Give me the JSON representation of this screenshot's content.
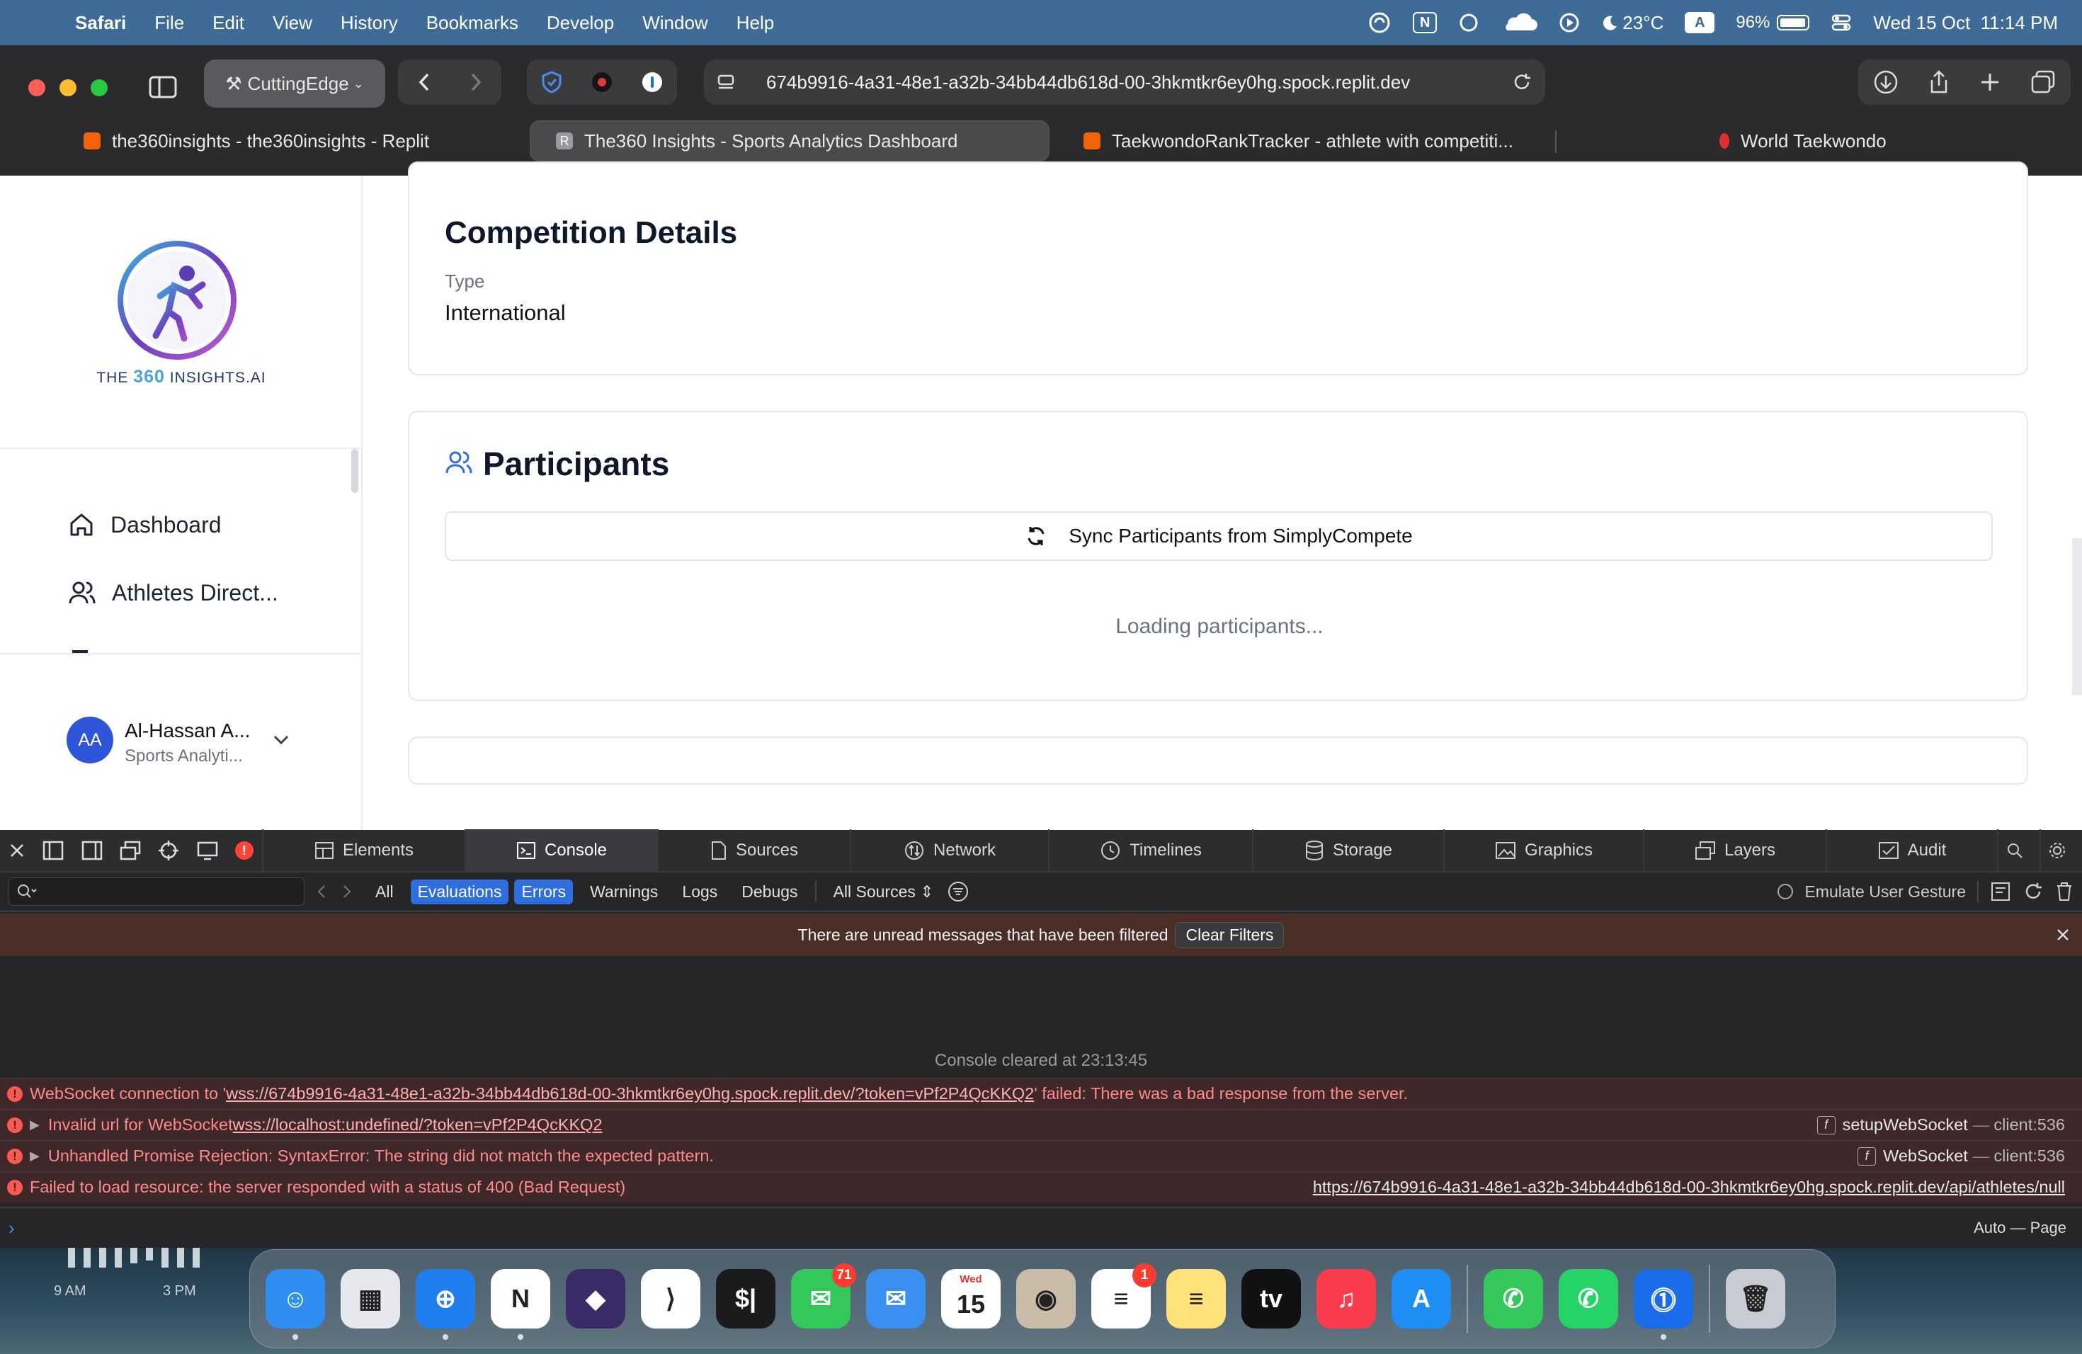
{
  "menubar": {
    "app": "Safari",
    "items": [
      "File",
      "Edit",
      "View",
      "History",
      "Bookmarks",
      "Develop",
      "Window",
      "Help"
    ],
    "weather": "23°C",
    "input_source": "A",
    "battery": "96%",
    "battery_level": 0.96,
    "datetime": "Wed 15 Oct  11:14 PM",
    "notion_glyph": "N"
  },
  "browser": {
    "profile": "CuttingEdge",
    "url": "674b9916-4a31-48e1-a32b-34bb44db618d-00-3hkmtkr6ey0hg.spock.replit.dev",
    "tabs": [
      {
        "label": "the360insights - the360insights - Replit",
        "favicon_color": "#f26207"
      },
      {
        "label": "The360 Insights - Sports Analytics Dashboard",
        "favicon_color": "#9a9aa0",
        "favicon_letter": "R"
      },
      {
        "label": "TaekwondoRankTracker - athlete with competiti...",
        "favicon_color": "#f26207"
      },
      {
        "label": "World Taekwondo",
        "favicon_color": "#e03030"
      }
    ]
  },
  "sidebar": {
    "logo_text_pre": "THE",
    "logo_text_num": "360",
    "logo_text_post": "INSIGHTS.AI",
    "nav": [
      {
        "label": "Dashboard",
        "icon": "home-icon"
      },
      {
        "label": "Athletes Direct...",
        "icon": "users-icon"
      }
    ],
    "user": {
      "initials": "AA",
      "name": "Al-Hassan A...",
      "role": "Sports Analyti..."
    }
  },
  "competition": {
    "title": "Competition Details",
    "type_label": "Type",
    "type_value": "International"
  },
  "participants": {
    "title": "Participants",
    "sync_label": "Sync Participants from SimplyCompete",
    "loading": "Loading participants..."
  },
  "devtools": {
    "tabs": [
      "Elements",
      "Console",
      "Sources",
      "Network",
      "Timelines",
      "Storage",
      "Graphics",
      "Layers",
      "Audit"
    ],
    "selected_tab": "Console",
    "filters": [
      "All",
      "Evaluations",
      "Errors",
      "Warnings",
      "Logs",
      "Debugs"
    ],
    "active_filters": [
      "Evaluations",
      "Errors"
    ],
    "sources": "All Sources",
    "emulate": "Emulate User Gesture",
    "notice": "There are unread messages that have been filtered",
    "clear_filters": "Clear Filters",
    "cleared": "Console cleared at 23:13:45",
    "errors": [
      {
        "pre": "WebSocket connection to '",
        "link": "wss://674b9916-4a31-48e1-a32b-34bb44db618d-00-3hkmtkr6ey0hg.spock.replit.dev/?token=vPf2P4QcKKQ2",
        "post": "' failed: There was a bad response from the server."
      },
      {
        "pre": "Invalid url for WebSocket ",
        "link": "wss://localhost:undefined/?token=vPf2P4QcKKQ2",
        "post": "",
        "fn": "setupWebSocket",
        "loc": "client:536"
      },
      {
        "pre": "Unhandled Promise Rejection: SyntaxError: The string did not match the expected pattern.",
        "link": "",
        "post": "",
        "fn": "WebSocket",
        "loc": "client:536"
      },
      {
        "pre": "Failed to load resource: the server responded with a status of 400 (Bad Request)",
        "link": "",
        "post": "",
        "url": "https://674b9916-4a31-48e1-a32b-34bb44db618d-00-3hkmtkr6ey0hg.spock.replit.dev/api/athletes/null"
      }
    ],
    "context": "Auto — Page",
    "separator": "—"
  },
  "desktop": {
    "widget_times": [
      "9 AM",
      "3 PM"
    ]
  },
  "dock": {
    "apps": [
      {
        "name": "Finder",
        "color": "#2f8ef0",
        "glyph": "☺"
      },
      {
        "name": "Launchpad",
        "color": "#e6e8ee",
        "glyph": "▦"
      },
      {
        "name": "Safari",
        "color": "#1f7ff0",
        "glyph": "⊕"
      },
      {
        "name": "Notion",
        "color": "#ffffff",
        "glyph": "N"
      },
      {
        "name": "Obsidian",
        "color": "#3a2a66",
        "glyph": "◆"
      },
      {
        "name": "VS Code",
        "color": "#ffffff",
        "glyph": "⟩"
      },
      {
        "name": "Terminal",
        "color": "#1b1b1b",
        "glyph": "$|"
      },
      {
        "name": "Messages",
        "color": "#34c759",
        "glyph": "✉",
        "badge": "71"
      },
      {
        "name": "Mail",
        "color": "#3b8ff0",
        "glyph": "✉"
      },
      {
        "name": "Calendar",
        "color": "#ffffff",
        "glyph": "15",
        "sub": "Wed"
      },
      {
        "name": "Contacts",
        "color": "#c9bca8",
        "glyph": "◉"
      },
      {
        "name": "Reminders",
        "color": "#ffffff",
        "glyph": "≡",
        "badge": "1"
      },
      {
        "name": "Notes",
        "color": "#ffe27a",
        "glyph": "≡"
      },
      {
        "name": "TV",
        "color": "#111111",
        "glyph": "tv"
      },
      {
        "name": "Music",
        "color": "#fa3c4c",
        "glyph": "♫"
      },
      {
        "name": "App Store",
        "color": "#1e8ef5",
        "glyph": "A"
      },
      {
        "name": "Phone",
        "color": "#34c759",
        "glyph": "✆"
      },
      {
        "name": "WhatsApp",
        "color": "#25d366",
        "glyph": "✆"
      },
      {
        "name": "1Password",
        "color": "#1a6ce8",
        "glyph": "⓵"
      },
      {
        "name": "Trash",
        "color": "#c8ccd2",
        "glyph": "🗑"
      }
    ]
  }
}
